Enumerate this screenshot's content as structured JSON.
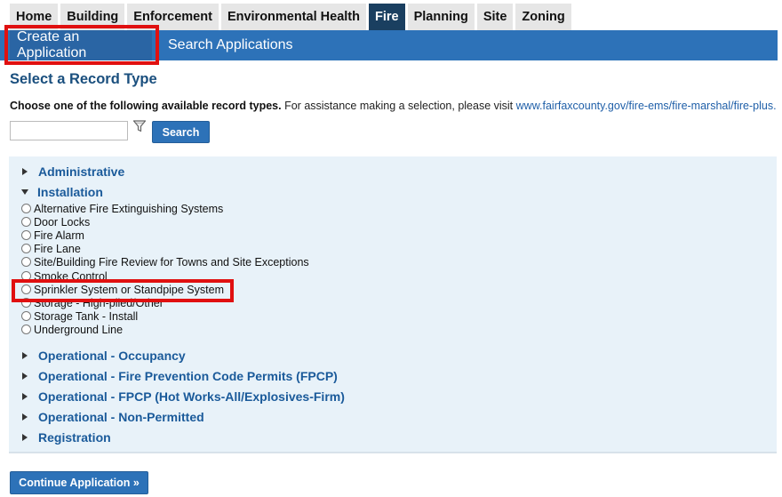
{
  "module_tabs": [
    "Home",
    "Building",
    "Enforcement",
    "Environmental Health",
    "Fire",
    "Planning",
    "Site",
    "Zoning"
  ],
  "active_tab": "Fire",
  "subnav": {
    "create_label": "Create an Application",
    "search_label": "Search Applications"
  },
  "page_title": "Select a Record Type",
  "instructions": {
    "bold": "Choose one of the following available record types.",
    "normal": "For assistance making a selection, please visit",
    "link": "www.fairfaxcounty.gov/fire-ems/fire-marshal/fire-plus."
  },
  "search": {
    "value": "",
    "button_label": "Search"
  },
  "categories": {
    "administrative": "Administrative",
    "installation": "Installation",
    "operational_occupancy": "Operational - Occupancy",
    "operational_fpcp": "Operational - Fire Prevention Code Permits (FPCP)",
    "operational_fpcp_hot": "Operational - FPCP (Hot Works-All/Explosives-Firm)",
    "operational_non": "Operational - Non-Permitted",
    "registration": "Registration"
  },
  "installation_options": [
    "Alternative Fire Extinguishing Systems",
    "Door Locks",
    "Fire Alarm",
    "Fire Lane",
    "Site/Building Fire Review for Towns and Site Exceptions",
    "Smoke Control",
    "Sprinkler System or Standpipe System",
    "Storage - High-piled/Other",
    "Storage Tank - Install",
    "Underground Line"
  ],
  "continue_label": "Continue Application »",
  "colors": {
    "nav_blue": "#2d72b8",
    "active_tab": "#1a3f60",
    "link_blue": "#1a5a9a",
    "highlight_red": "#e01010",
    "panel_bg": "#e8f2f9"
  }
}
